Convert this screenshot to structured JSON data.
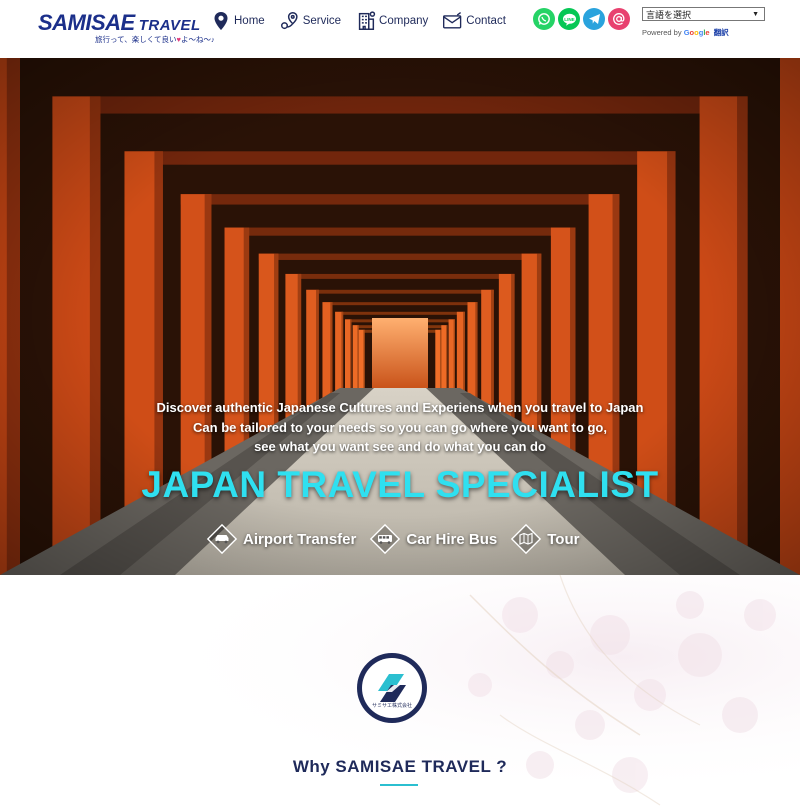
{
  "header": {
    "logo": {
      "brand": "SAMISAE",
      "travel": "TRAVEL",
      "tagline_left": "旅行って、楽しくて良い",
      "tagline_heart": "♥",
      "tagline_right": "よ〜ね〜♪"
    },
    "nav": [
      {
        "label": "Home",
        "icon": "map-pin-icon"
      },
      {
        "label": "Service",
        "icon": "route-icon"
      },
      {
        "label": "Company",
        "icon": "building-icon"
      },
      {
        "label": "Contact",
        "icon": "mail-icon"
      }
    ],
    "social": [
      {
        "name": "whatsapp",
        "icon": "whatsapp-icon",
        "color": "#25d366"
      },
      {
        "name": "line",
        "icon": "line-icon",
        "color": "#06c755"
      },
      {
        "name": "telegram",
        "icon": "telegram-icon",
        "color": "#2aa3dd"
      },
      {
        "name": "email",
        "icon": "at-icon",
        "color": "#e8416f"
      }
    ],
    "translate": {
      "select_value": "言語を選択",
      "powered_by": "Powered by",
      "google": [
        "G",
        "o",
        "o",
        "g",
        "l",
        "e"
      ],
      "translate_label": "翻訳"
    }
  },
  "hero": {
    "tagline": [
      "Discover authentic Japanese Cultures and Experiens when you travel to Japan",
      "Can be tailored to your needs so you can go where you want to go,",
      "see what you want see and do what you can do"
    ],
    "title": "JAPAN TRAVEL SPECIALIST",
    "title_color": "#2fe0f0",
    "services": [
      {
        "label": "Airport Transfer",
        "icon": "car-icon"
      },
      {
        "label": "Car Hire Bus",
        "icon": "bus-icon"
      },
      {
        "label": "Tour",
        "icon": "map-icon"
      }
    ]
  },
  "about": {
    "emblem_caption": "サミサエ株式会社",
    "title": "Why SAMISAE TRAVEL ?",
    "accent": "#2bbfd0"
  }
}
